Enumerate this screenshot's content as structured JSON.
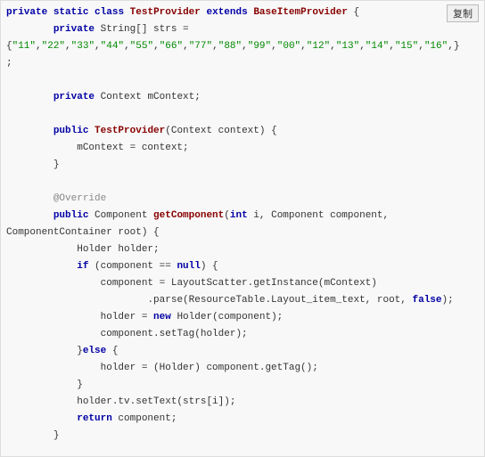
{
  "copy_button_label": "复制",
  "code": {
    "line1": {
      "kw_private": "private",
      "kw_static": "static",
      "kw_class": "class",
      "type_testprovider": "TestProvider",
      "kw_extends": "extends",
      "type_baseitemprovider": "BaseItemProvider",
      "tail": " {"
    },
    "line2": {
      "kw_private": "private",
      "rest": " String[] strs ="
    },
    "line3": {
      "open": "{",
      "s0": "\"11\"",
      "c0": ",",
      "s1": "\"22\"",
      "c1": ",",
      "s2": "\"33\"",
      "c2": ",",
      "s3": "\"44\"",
      "c3": ",",
      "s4": "\"55\"",
      "c4": ",",
      "s5": "\"66\"",
      "c5": ",",
      "s6": "\"77\"",
      "c6": ",",
      "s7": "\"88\"",
      "c7": ",",
      "s8": "\"99\"",
      "c8": ",",
      "s9": "\"00\"",
      "c9": ",",
      "s10": "\"12\"",
      "c10": ",",
      "s11": "\"13\"",
      "c11": ",",
      "s12": "\"14\"",
      "c12": ",",
      "s13": "\"15\"",
      "c13": ",",
      "s14": "\"16\"",
      "c14": ",}"
    },
    "line4": ";",
    "line6": {
      "kw_private": "private",
      "rest": " Context mContext;"
    },
    "line8": {
      "kw_public": "public",
      "ctor": "TestProvider",
      "params": "(Context context) {"
    },
    "line9": "mContext = context;",
    "line10": "}",
    "line12_ann": "@Override",
    "line13": {
      "kw_public": "public",
      "sp1": " Component ",
      "fn": "getComponent",
      "p_open": "(",
      "kw_int": "int",
      "p_rest": " i, Component component,"
    },
    "line14": "ComponentContainer root) {",
    "line15": "Holder holder;",
    "line16": {
      "kw_if": "if",
      "cond": " (component == ",
      "kw_null": "null",
      "tail": ") {"
    },
    "line17": "component = LayoutScatter.getInstance(mContext)",
    "line18": {
      "pre": ".parse(ResourceTable.Layout_item_text, root, ",
      "lit_false": "false",
      "post": ");"
    },
    "line19": {
      "pre": "holder = ",
      "kw_new": "new",
      "post": " Holder(component);"
    },
    "line20": "component.setTag(holder);",
    "line21": {
      "close": "}",
      "kw_else": "else",
      "open": " {"
    },
    "line22": "holder = (Holder) component.getTag();",
    "line23": "}",
    "line24": "holder.tv.setText(strs[i]);",
    "line25": {
      "kw_return": "return",
      "rest": " component;"
    },
    "line26": "}"
  }
}
